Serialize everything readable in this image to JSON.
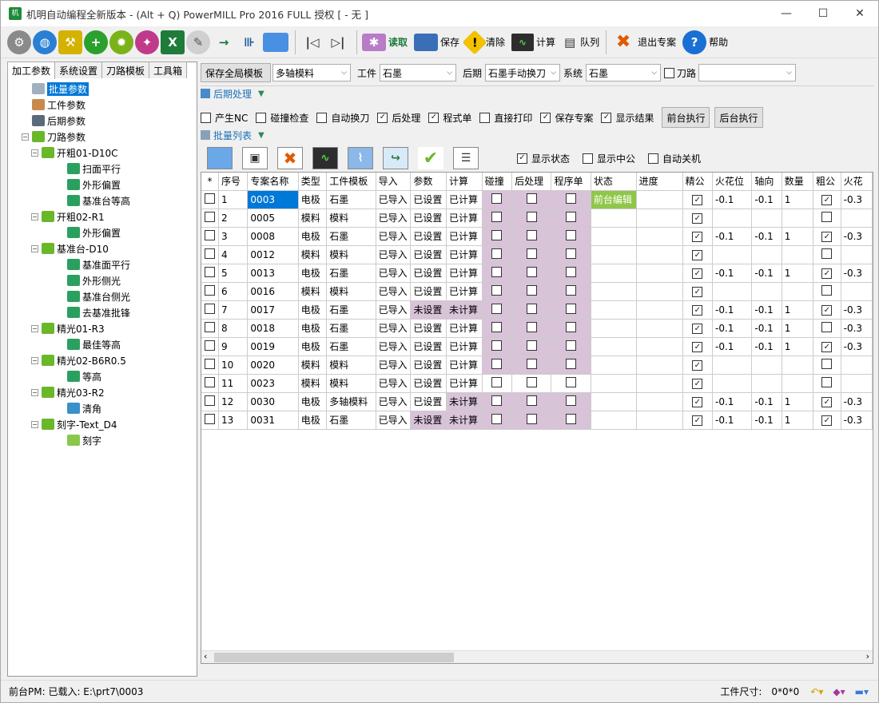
{
  "window": {
    "title": "机明自动编程全新版本 - (Alt + Q) PowerMILL Pro 2016 FULL 授权   [  - 无 ]",
    "app_icon": "机",
    "min": "—",
    "max": "☐",
    "close": "✕"
  },
  "toolbar": {
    "read": "读取",
    "save": "保存",
    "clear": "清除",
    "calc": "计算",
    "queue": "队列",
    "exit": "退出专案",
    "help": "帮助"
  },
  "tabs": [
    "加工参数",
    "系统设置",
    "刀路模板",
    "工具箱"
  ],
  "tree": [
    {
      "label": "批量参数",
      "level": 1,
      "selected": true,
      "icon": "batch-icon"
    },
    {
      "label": "工件参数",
      "level": 1,
      "icon": "workpiece-icon"
    },
    {
      "label": "后期参数",
      "level": 1,
      "icon": "post-icon"
    },
    {
      "label": "刀路参数",
      "level": 1,
      "exp": "−",
      "icon": "toolpath-icon"
    },
    {
      "label": "开粗01-D10C",
      "level": 2,
      "exp": "−",
      "icon": "toolpath-icon"
    },
    {
      "label": "扫面平行",
      "level": 3,
      "icon": "layer-icon"
    },
    {
      "label": "外形偏置",
      "level": 3,
      "icon": "layer-icon"
    },
    {
      "label": "基准台等高",
      "level": 3,
      "icon": "layer-icon"
    },
    {
      "label": "开粗02-R1",
      "level": 2,
      "exp": "−",
      "icon": "toolpath-icon"
    },
    {
      "label": "外形偏置",
      "level": 3,
      "icon": "layer-icon"
    },
    {
      "label": "基准台-D10",
      "level": 2,
      "exp": "−",
      "icon": "toolpath-icon"
    },
    {
      "label": "基准面平行",
      "level": 3,
      "icon": "layer-icon"
    },
    {
      "label": "外形侧光",
      "level": 3,
      "icon": "layer-icon"
    },
    {
      "label": "基准台侧光",
      "level": 3,
      "icon": "layer-icon"
    },
    {
      "label": "去基准批锋",
      "level": 3,
      "icon": "layer-icon"
    },
    {
      "label": "精光01-R3",
      "level": 2,
      "exp": "−",
      "icon": "toolpath-icon"
    },
    {
      "label": "最佳等高",
      "level": 3,
      "icon": "layer-icon"
    },
    {
      "label": "精光02-B6R0.5",
      "level": 2,
      "exp": "−",
      "icon": "toolpath-icon"
    },
    {
      "label": "等高",
      "level": 3,
      "icon": "layer-icon"
    },
    {
      "label": "精光03-R2",
      "level": 2,
      "exp": "−",
      "icon": "toolpath-icon"
    },
    {
      "label": "清角",
      "level": 3,
      "icon": "corner-icon"
    },
    {
      "label": "刻字-Text_D4",
      "level": 2,
      "exp": "−",
      "icon": "toolpath-icon"
    },
    {
      "label": "刻字",
      "level": 3,
      "icon": "engrave-icon"
    }
  ],
  "top": {
    "save_template": "保存全局模板",
    "template_value": "多轴模料",
    "workpiece_label": "工件",
    "workpiece_value": "石墨",
    "post_label": "后期",
    "post_value": "石墨手动换刀",
    "system_label": "系统",
    "system_value": "石墨",
    "toolpath_label": "刀路",
    "toolpath_value": ""
  },
  "sections": {
    "post": "后期处理",
    "batch": "批量列表"
  },
  "options": [
    {
      "label": "产生NC",
      "checked": false
    },
    {
      "label": "碰撞检查",
      "checked": false
    },
    {
      "label": "自动换刀",
      "checked": false
    },
    {
      "label": "后处理",
      "checked": true
    },
    {
      "label": "程式单",
      "checked": true
    },
    {
      "label": "直接打印",
      "checked": false
    },
    {
      "label": "保存专案",
      "checked": true
    },
    {
      "label": "显示结果",
      "checked": true
    }
  ],
  "run": {
    "front": "前台执行",
    "back": "后台执行"
  },
  "display": [
    {
      "label": "显示状态",
      "checked": true
    },
    {
      "label": "显示中公",
      "checked": false
    },
    {
      "label": "自动关机",
      "checked": false
    }
  ],
  "columns": [
    "*",
    "序号",
    "专案名称",
    "类型",
    "工件模板",
    "导入",
    "参数",
    "计算",
    "碰撞",
    "后处理",
    "程序单",
    "状态",
    "进度",
    "精公",
    "火花位",
    "轴向",
    "数量",
    "粗公",
    "火花"
  ],
  "rows": [
    {
      "no": "1",
      "name": "0003",
      "type": "电极",
      "tpl": "石墨",
      "imp": "已导入",
      "param": "已设置",
      "calc": "已计算",
      "status": "前台编辑",
      "fine": true,
      "spark": "-0.1",
      "axis": "-0.1",
      "qty": "1",
      "rough": true,
      "spark2": "-0.3"
    },
    {
      "no": "2",
      "name": "0005",
      "type": "模料",
      "tpl": "模料",
      "imp": "已导入",
      "param": "已设置",
      "calc": "已计算",
      "status": "",
      "fine": true,
      "spark": "",
      "axis": "",
      "qty": "",
      "rough": false,
      "spark2": ""
    },
    {
      "no": "3",
      "name": "0008",
      "type": "电极",
      "tpl": "石墨",
      "imp": "已导入",
      "param": "已设置",
      "calc": "已计算",
      "status": "",
      "fine": true,
      "spark": "-0.1",
      "axis": "-0.1",
      "qty": "1",
      "rough": true,
      "spark2": "-0.3"
    },
    {
      "no": "4",
      "name": "0012",
      "type": "模料",
      "tpl": "模料",
      "imp": "已导入",
      "param": "已设置",
      "calc": "已计算",
      "status": "",
      "fine": true,
      "spark": "",
      "axis": "",
      "qty": "",
      "rough": false,
      "spark2": ""
    },
    {
      "no": "5",
      "name": "0013",
      "type": "电极",
      "tpl": "石墨",
      "imp": "已导入",
      "param": "已设置",
      "calc": "已计算",
      "status": "",
      "fine": true,
      "spark": "-0.1",
      "axis": "-0.1",
      "qty": "1",
      "rough": true,
      "spark2": "-0.3"
    },
    {
      "no": "6",
      "name": "0016",
      "type": "模料",
      "tpl": "模料",
      "imp": "已导入",
      "param": "已设置",
      "calc": "已计算",
      "status": "",
      "fine": true,
      "spark": "",
      "axis": "",
      "qty": "",
      "rough": false,
      "spark2": ""
    },
    {
      "no": "7",
      "name": "0017",
      "type": "电极",
      "tpl": "石墨",
      "imp": "已导入",
      "param": "未设置",
      "calc": "未计算",
      "status": "",
      "fine": true,
      "spark": "-0.1",
      "axis": "-0.1",
      "qty": "1",
      "rough": true,
      "spark2": "-0.3"
    },
    {
      "no": "8",
      "name": "0018",
      "type": "电极",
      "tpl": "石墨",
      "imp": "已导入",
      "param": "已设置",
      "calc": "已计算",
      "status": "",
      "fine": true,
      "spark": "-0.1",
      "axis": "-0.1",
      "qty": "1",
      "rough": false,
      "spark2": "-0.3"
    },
    {
      "no": "9",
      "name": "0019",
      "type": "电极",
      "tpl": "石墨",
      "imp": "已导入",
      "param": "已设置",
      "calc": "已计算",
      "status": "",
      "fine": true,
      "spark": "-0.1",
      "axis": "-0.1",
      "qty": "1",
      "rough": true,
      "spark2": "-0.3"
    },
    {
      "no": "10",
      "name": "0020",
      "type": "模料",
      "tpl": "模料",
      "imp": "已导入",
      "param": "已设置",
      "calc": "已计算",
      "status": "",
      "fine": true,
      "spark": "",
      "axis": "",
      "qty": "",
      "rough": false,
      "spark2": ""
    },
    {
      "no": "11",
      "name": "0023",
      "type": "模料",
      "tpl": "模料",
      "imp": "已导入",
      "param": "已设置",
      "calc": "已计算",
      "status": "",
      "fine": true,
      "spark": "",
      "axis": "",
      "qty": "",
      "rough": false,
      "spark2": "",
      "nopurple": true
    },
    {
      "no": "12",
      "name": "0030",
      "type": "电极",
      "tpl": "多轴模料",
      "imp": "已导入",
      "param": "已设置",
      "calc": "未计算",
      "status": "",
      "fine": true,
      "spark": "-0.1",
      "axis": "-0.1",
      "qty": "1",
      "rough": true,
      "spark2": "-0.3"
    },
    {
      "no": "13",
      "name": "0031",
      "type": "电极",
      "tpl": "石墨",
      "imp": "已导入",
      "param": "未设置",
      "calc": "未计算",
      "status": "",
      "fine": true,
      "spark": "-0.1",
      "axis": "-0.1",
      "qty": "1",
      "rough": true,
      "spark2": "-0.3"
    }
  ],
  "status": {
    "left": "前台PM: 已载入: E:\\prt7\\0003",
    "size_label": "工件尺寸:",
    "size_value": "0*0*0"
  }
}
